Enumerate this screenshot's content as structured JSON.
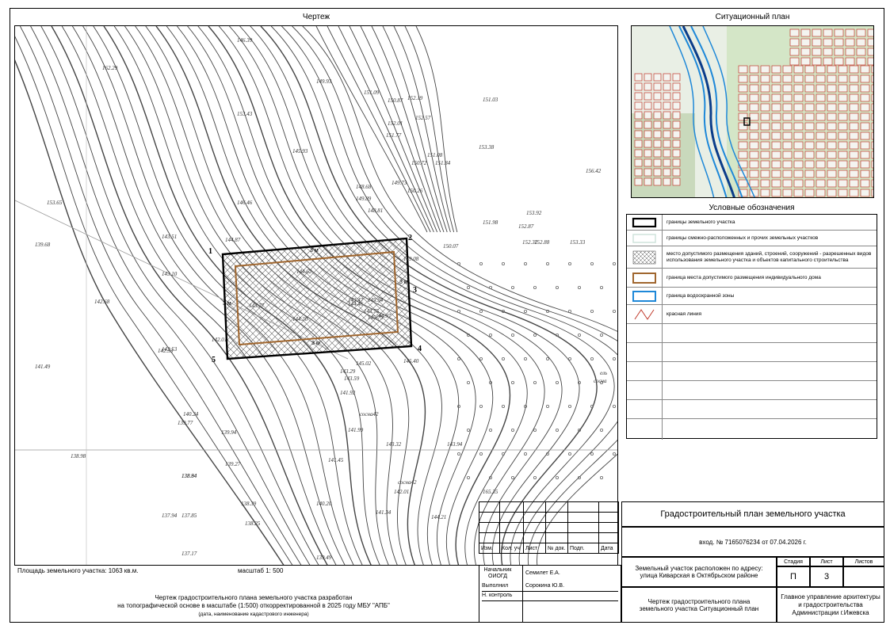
{
  "drawing_title": "Чертеж",
  "situation_title": "Ситуационный план",
  "legend_title": "Условные обозначения",
  "legend_items": [
    {
      "symbol": "black-boundary",
      "label": "границы земельного участка"
    },
    {
      "symbol": "light-boundary",
      "label": "границы смежно-расположенных  и прочих земельных участков"
    },
    {
      "symbol": "hatch",
      "label": "место допустимого размещения зданий, строений, сооружений - разрешенных видов использования земельного участка и объектов капитального строительства"
    },
    {
      "symbol": "brown-boundary",
      "label": "граница места допустимого размещения индивидуального дома"
    },
    {
      "symbol": "blue-boundary",
      "label": "граница водоохранной зоны"
    },
    {
      "symbol": "red-line",
      "label": "красная линия"
    }
  ],
  "colors": {
    "plot": "#000000",
    "house_zone": "#a0662e",
    "water_zone": "#1e88d8",
    "red_line": "#c0392b",
    "neighbors": "#cfe3dc"
  },
  "plot_points": [
    "1",
    "2",
    "3",
    "4",
    "5"
  ],
  "setbacks": [
    "3 м",
    "3 м",
    "3 м",
    "3 м"
  ],
  "elevations": [
    "162.29",
    "146.39",
    "149.93",
    "151.09",
    "150.87",
    "152.19",
    "152.57",
    "152.01",
    "151.77",
    "151.03",
    "153.43",
    "145.93",
    "148.68",
    "149.73",
    "151.08",
    "150.72",
    "151.84",
    "149.89",
    "150.26",
    "150.07",
    "153.38",
    "146.46",
    "148.81",
    "152.32",
    "153.92",
    "151.98",
    "152.87",
    "152.88",
    "153.33",
    "156.42",
    "153.65",
    "143.51",
    "144.87",
    "149.08",
    "139.68",
    "143.10",
    "142.68",
    "143.77",
    "144.30",
    "144.46",
    "145.75",
    "145.94",
    "142.53",
    "142.33",
    "144.62",
    "143.47",
    "143.75",
    "144.97",
    "142.01",
    "145.02",
    "145.40",
    "141.49",
    "143.29",
    "143.59",
    "141.92",
    "140.24",
    "139.77",
    "139.94",
    "141.99",
    "143.32",
    "143.94",
    "138.98",
    "139.27",
    "138.94",
    "138.84",
    "141.45",
    "142.01",
    "141.34",
    "144.21",
    "138.39",
    "140.20",
    "137.94",
    "137.85",
    "138.25",
    "137.17",
    "139.49",
    "165.35"
  ],
  "tree_labels": [
    "ель",
    "сосна",
    "сосна42",
    "сосна42"
  ],
  "footer": {
    "area": "Площадь земельного участка: 1063 кв.м.",
    "scale": "масштаб  1: 500",
    "note_line1": "Чертеж градостроительного плана земельного участка разработан",
    "note_line2": "на топографической основе в масштабе (1:500) откорректированной в 2025 году МБУ \"АПБ\"",
    "note_line3": "(дата, наименование кадастрового инженера)"
  },
  "stamp": {
    "headers": [
      "Изм.",
      "Кол. уч",
      "Лист",
      "№ док.",
      "Подп.",
      "Дата"
    ],
    "role1": "Начальник ОИОГД",
    "person1": "Семилет Е.А.",
    "role2": "Выполнил",
    "person2": "Сорокина Ю.В.",
    "role3": "Н. контроль",
    "person3": ""
  },
  "title_block": {
    "doc_title": "Градостроительный план земельного участка",
    "incoming": "вход. № 7165076234 от 07.04.2026 г.",
    "location": "Земельный участок расположен по адресу: улица Киварская в Октябрьском районе",
    "stage_label": "Стадия",
    "sheet_label": "Лист",
    "sheets_label": "Листов",
    "stage_value": "П",
    "sheet_value": "3",
    "sheets_value": "",
    "drawing_name": "Чертеж градостроительного плана земельного участка Ситуационный план",
    "organization": "Главное управление архитектуры и градостроительства Администрации г.Ижевска"
  }
}
